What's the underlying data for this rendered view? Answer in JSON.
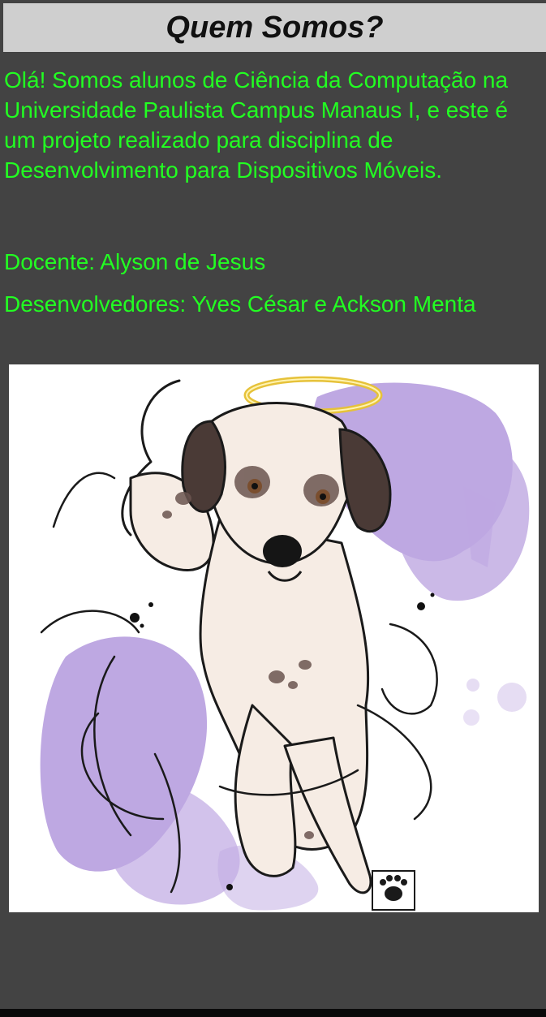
{
  "header": {
    "title": "Quem Somos?"
  },
  "content": {
    "intro": "Olá! Somos alunos de Ciência da Computação na Universidade Paulista Campus Manaus I, e este é um projeto realizado para disciplina de Desenvolvimento para Dispositivos Móveis.",
    "docente": "Docente: Alyson de Jesus",
    "desenvolvedores": "Desenvolvedores: Yves César e Ackson Menta"
  },
  "illustration": {
    "subject": "dog-with-halo-illustration",
    "stamp_icon": "paw-print-logo-icon"
  },
  "colors": {
    "background": "#434343",
    "title_bar": "#cfcfcf",
    "text": "#22ff22",
    "watercolor": "#a88ad6"
  }
}
